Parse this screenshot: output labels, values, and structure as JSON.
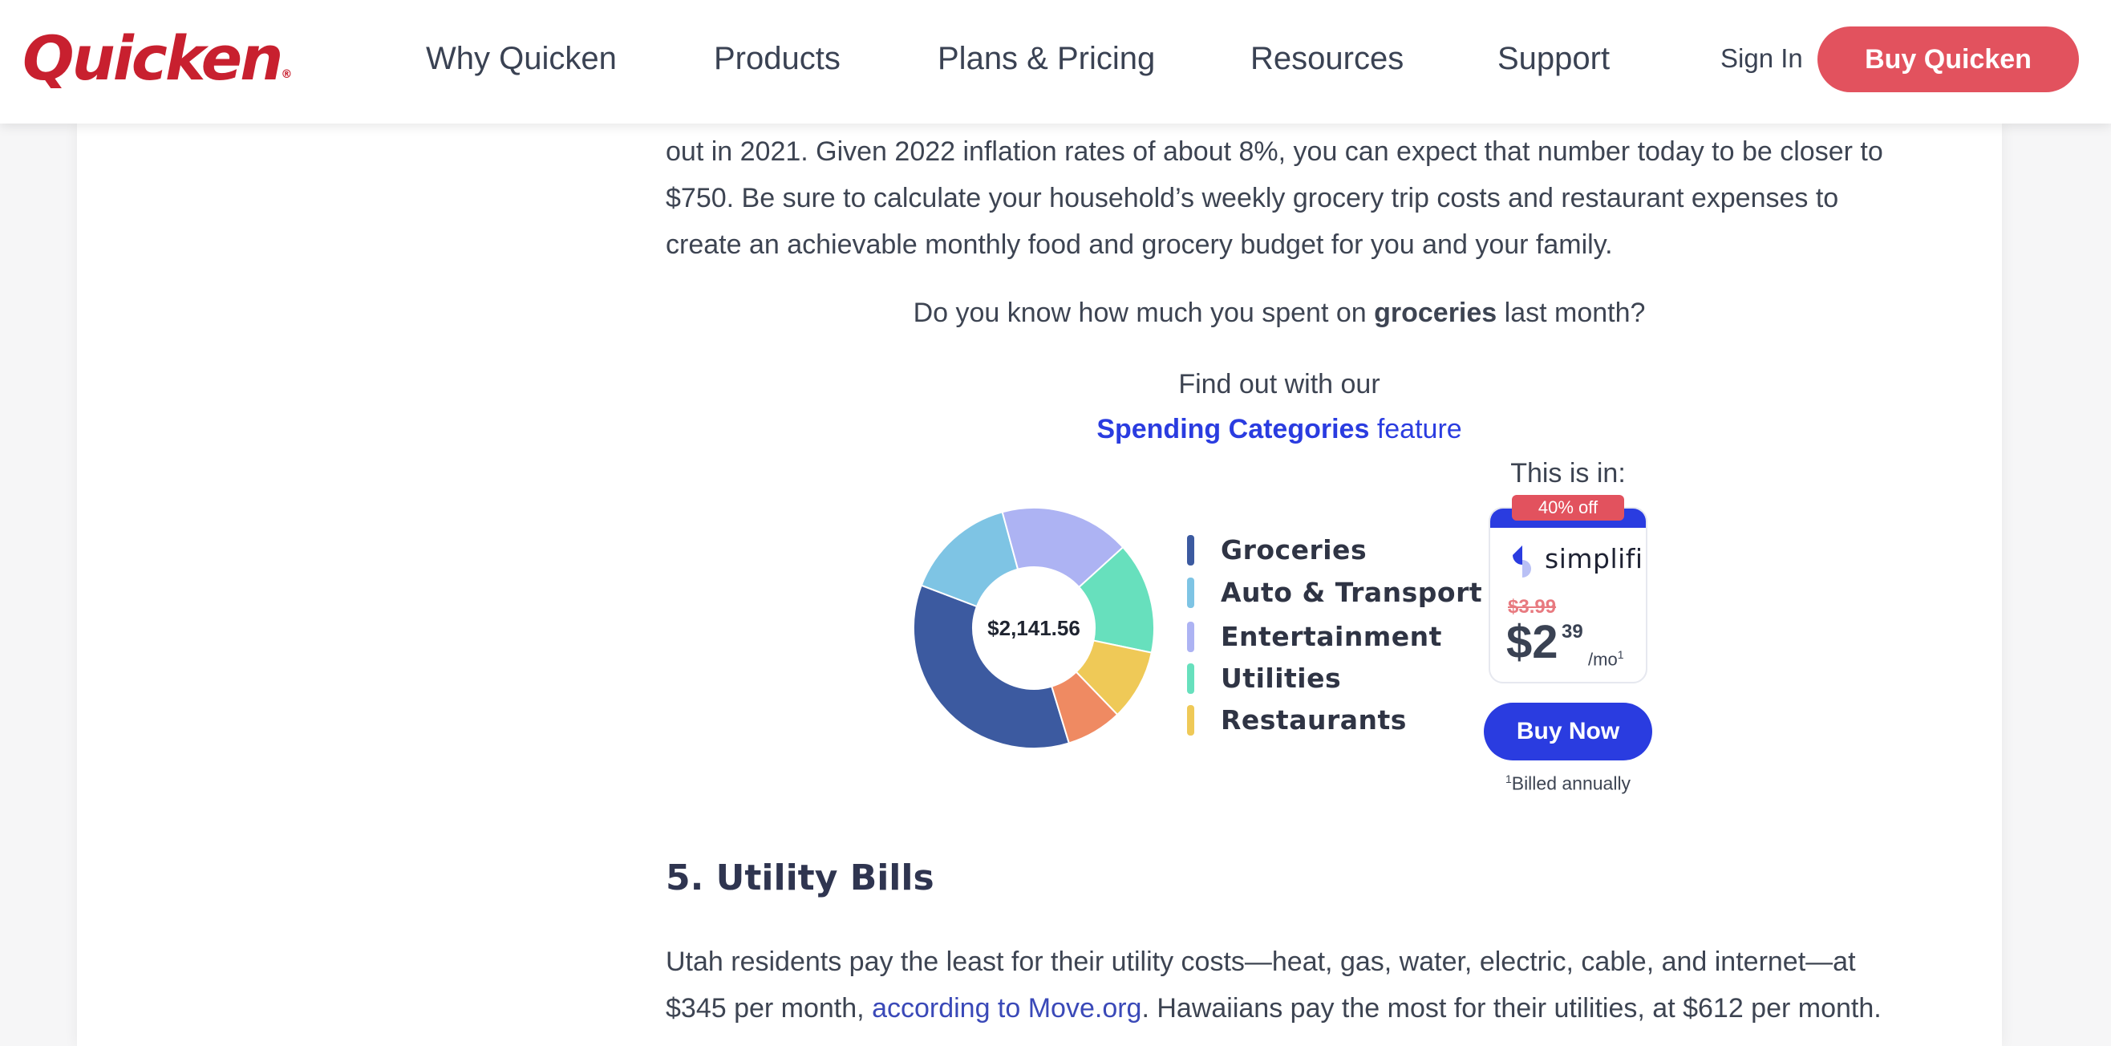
{
  "header": {
    "logo": "Quicken",
    "logo_mark": "®",
    "nav": [
      "Why Quicken",
      "Products",
      "Plans & Pricing",
      "Resources",
      "Support"
    ],
    "sign_in": "Sign In",
    "buy": "Buy Quicken"
  },
  "article": {
    "para1_lines": [
      "out in 2021. Given 2022 inflation rates of about 8%, you can expect that number today to be closer to",
      "$750. Be sure to calculate your household’s weekly grocery trip costs and restaurant expenses to",
      "create an achievable monthly food and grocery budget for you and your family."
    ],
    "question_pre": "Do you know how much you spent on ",
    "question_bold": "groceries",
    "question_post": " last month?",
    "find_out": "Find out with our",
    "feature_link": "Spending Categories",
    "feature_suffix": " feature",
    "heading": "5. Utility Bills",
    "para2_line1": "Utah residents pay the least for their utility costs—heat, gas, water, electric, cable, and internet—at",
    "para2_line2_pre": "$345 per month, ",
    "para2_link": "according to Move.org",
    "para2_line2_post": ". Hawaiians pay the most for their utilities, at $612 per month."
  },
  "chart_data": {
    "type": "pie",
    "center_label": "$2,141.56",
    "legend": [
      "Groceries",
      "Auto & Transport",
      "Entertainment",
      "Utilities",
      "Restaurants"
    ],
    "legend_colors": [
      "#3c5aa0",
      "#7ec4e4",
      "#adb3f3",
      "#67e0bd",
      "#efc957"
    ],
    "slices": [
      {
        "color": "#3c5aa0",
        "value": 0.355
      },
      {
        "color": "#7ec4e4",
        "value": 0.15
      },
      {
        "color": "#adb3f3",
        "value": 0.175
      },
      {
        "color": "#67e0bd",
        "value": 0.15
      },
      {
        "color": "#efc957",
        "value": 0.095
      },
      {
        "color": "#ef8a62",
        "value": 0.075
      }
    ]
  },
  "product": {
    "intro": "This is in:",
    "discount": "40% off",
    "name": "simplifi",
    "old_price": "$3.99",
    "price_dollars": "$2",
    "price_cents": "39",
    "price_unit": "/mo",
    "footnote_mark": "1",
    "buy_now": "Buy Now",
    "billed": "Billed annually",
    "colors": {
      "accent": "#2a3ce0",
      "badge": "#e2525e"
    }
  },
  "colors": {
    "brand": "#c8202f",
    "cta": "#e2525e"
  }
}
